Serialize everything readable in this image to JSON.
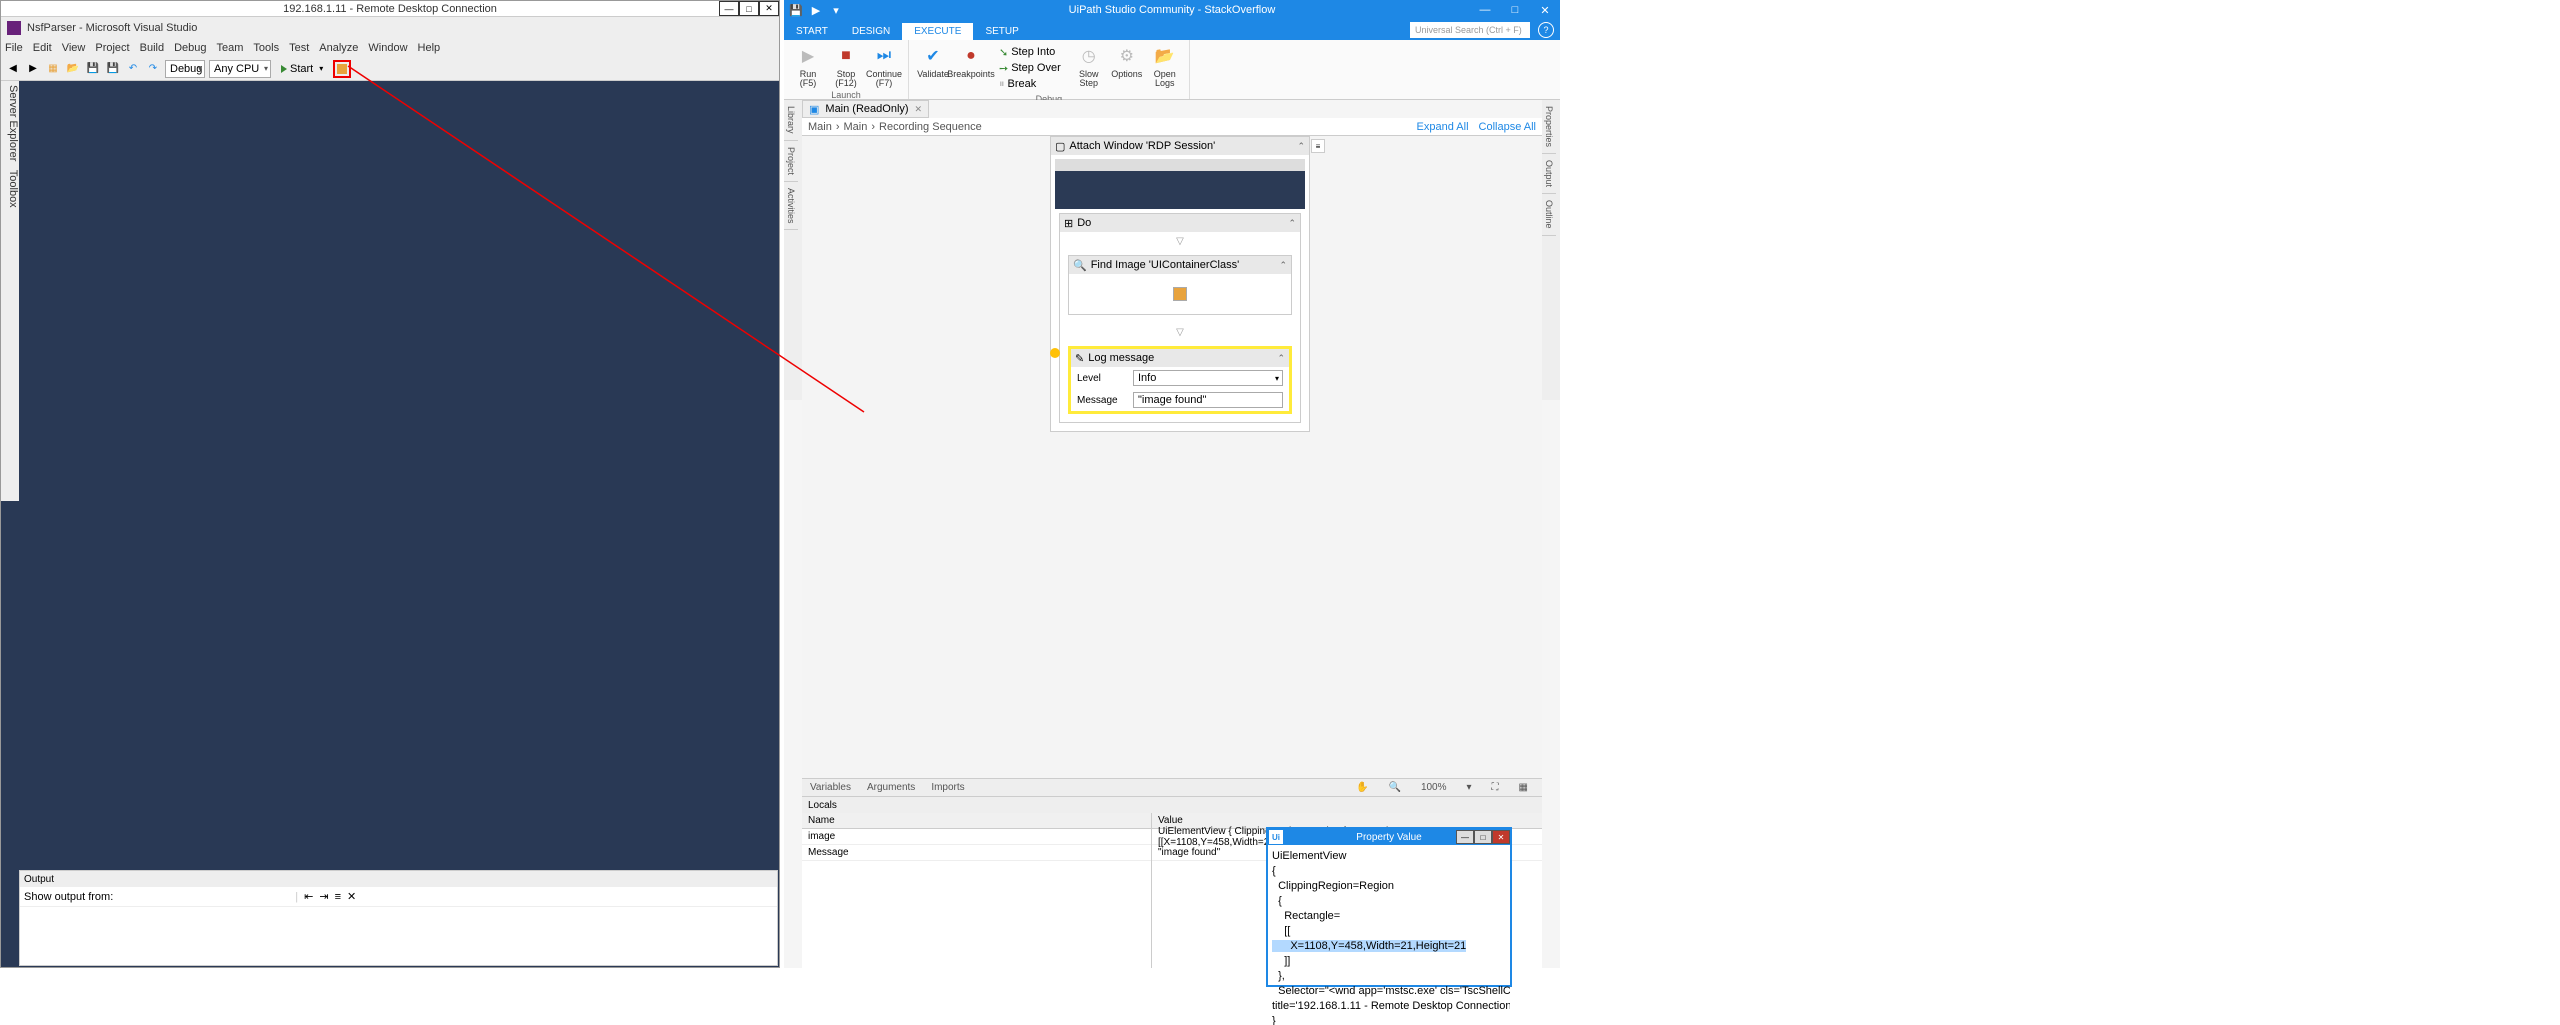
{
  "rdp": {
    "title": "192.168.1.11 - Remote Desktop Connection"
  },
  "vs": {
    "title": "NsfParser - Microsoft Visual Studio",
    "menu": [
      "File",
      "Edit",
      "View",
      "Project",
      "Build",
      "Debug",
      "Team",
      "Tools",
      "Test",
      "Analyze",
      "Window",
      "Help"
    ],
    "config": "Debug",
    "platform": "Any CPU",
    "start": "Start",
    "side": [
      "Server Explorer",
      "Toolbox"
    ],
    "output_header": "Output",
    "output_label": "Show output from:"
  },
  "up": {
    "title": "UiPath Studio Community - StackOverflow",
    "tabs": [
      "START",
      "DESIGN",
      "EXECUTE",
      "SETUP"
    ],
    "search_placeholder": "Universal Search (Ctrl + F)",
    "ribbon": {
      "run": "Run\n(F5)",
      "stop": "Stop\n(F12)",
      "cont": "Continue\n(F7)",
      "validate": "Validate",
      "breakpoints": "Breakpoints",
      "stepinto": "Step Into",
      "stepover": "Step Over",
      "break": "Break",
      "slowstep": "Slow\nStep",
      "options": "Options",
      "openlogs": "Open\nLogs",
      "g_launch": "Launch",
      "g_debug": "Debug"
    },
    "doc_tab": "Main (ReadOnly)",
    "crumb": [
      "Main",
      "Main",
      "Recording Sequence"
    ],
    "expand": "Expand All",
    "collapse": "Collapse All",
    "attach": "Attach Window 'RDP Session'",
    "do": "Do",
    "find": "Find Image 'UIContainerClass'",
    "log": "Log message",
    "level_lbl": "Level",
    "level_val": "Info",
    "msg_lbl": "Message",
    "msg_val": "\"image found\"",
    "btabs": [
      "Variables",
      "Arguments",
      "Imports"
    ],
    "zoom": "100%",
    "locals": "Locals",
    "col_name": "Name",
    "col_value": "Value",
    "row_image": "image",
    "row_message": "Message",
    "val_image": "UiElementView { ClippingRegion=Region { Rectangle= [[X=1108,Y=458,Width=21,Height=21]] }, Selector=\"<",
    "val_message": "\"image found\"",
    "popup_title": "Property Value",
    "popup_body_pre": "UiElementView\n{\n  ClippingRegion=Region\n  {\n    Rectangle=\n    [[\n",
    "popup_body_hl": "      X=1108,Y=458,Width=21,Height=21",
    "popup_body_post": "\n    ]]\n  },\n  Selector=\"<wnd app='mstsc.exe' cls='TscShellContainerClass'\ntitle='192.168.1.11 - Remote Desktop Connection' />\"\n}",
    "left_tabs": [
      "Library",
      "Project",
      "Activities"
    ],
    "right_tabs": [
      "Properties",
      "Output",
      "Outline"
    ]
  }
}
